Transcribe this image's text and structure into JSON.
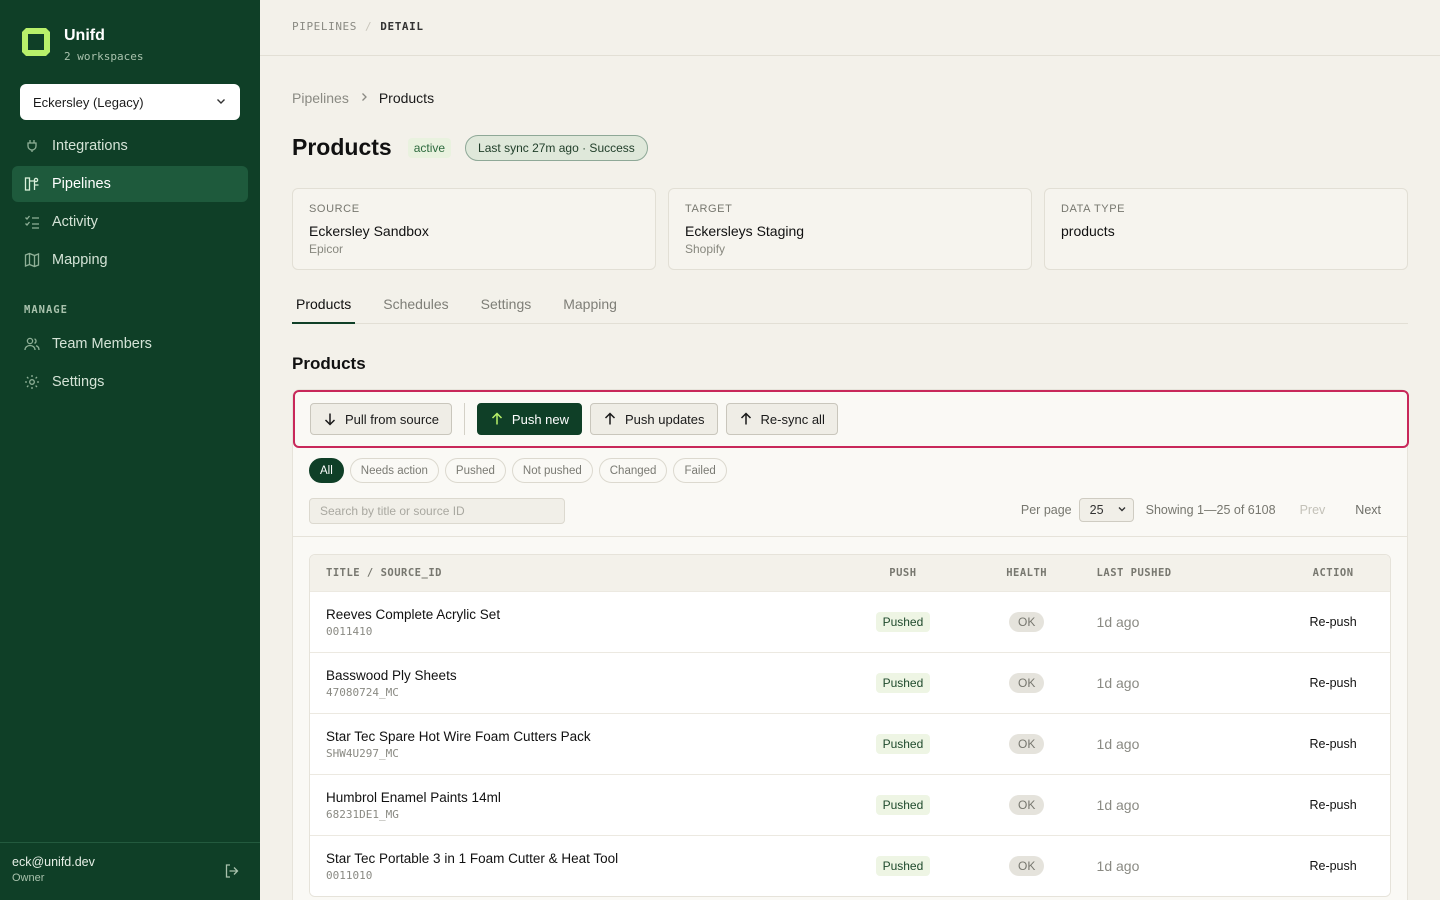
{
  "app": {
    "name": "Unifd",
    "workspaces": "2 workspaces",
    "workspace_selected": "Eckersley (Legacy)"
  },
  "sidebar": {
    "items": [
      {
        "label": "Integrations",
        "icon": "plug-icon"
      },
      {
        "label": "Pipelines",
        "icon": "pipeline-icon",
        "active": true
      },
      {
        "label": "Activity",
        "icon": "list-check-icon"
      },
      {
        "label": "Mapping",
        "icon": "map-icon"
      }
    ],
    "manage_label": "MANAGE",
    "manage_items": [
      {
        "label": "Team Members",
        "icon": "users-icon"
      },
      {
        "label": "Settings",
        "icon": "gear-icon"
      }
    ],
    "user": {
      "email": "eck@unifd.dev",
      "role": "Owner"
    }
  },
  "topbar": {
    "section": "PIPELINES",
    "separator": "/",
    "current": "DETAIL"
  },
  "breadcrumb": {
    "parent": "Pipelines",
    "current": "Products"
  },
  "header": {
    "title": "Products",
    "status": "active",
    "sync": "Last sync 27m ago · Success"
  },
  "cards": [
    {
      "label": "SOURCE",
      "value": "Eckersley Sandbox",
      "sub": "Epicor"
    },
    {
      "label": "TARGET",
      "value": "Eckersleys Staging",
      "sub": "Shopify"
    },
    {
      "label": "DATA TYPE",
      "value": "products",
      "sub": ""
    }
  ],
  "tabs": [
    "Products",
    "Schedules",
    "Settings",
    "Mapping"
  ],
  "section_title": "Products",
  "actions": {
    "pull": "Pull from source",
    "push_new": "Push new",
    "push_updates": "Push updates",
    "resync": "Re-sync all"
  },
  "filters": [
    "All",
    "Needs action",
    "Pushed",
    "Not pushed",
    "Changed",
    "Failed"
  ],
  "search": {
    "placeholder": "Search by title or source ID"
  },
  "pager": {
    "per_page_label": "Per page",
    "per_page": "25",
    "showing": "Showing 1—25 of 6108",
    "prev": "Prev",
    "next": "Next"
  },
  "table": {
    "headers": {
      "title": "TITLE / SOURCE_ID",
      "push": "PUSH",
      "health": "HEALTH",
      "last": "LAST PUSHED",
      "action": "ACTION"
    },
    "rows": [
      {
        "title": "Reeves Complete Acrylic Set",
        "id": "0011410",
        "push": "Pushed",
        "health": "OK",
        "last": "1d ago",
        "action": "Re-push"
      },
      {
        "title": "Basswood Ply Sheets",
        "id": "47080724_MC",
        "push": "Pushed",
        "health": "OK",
        "last": "1d ago",
        "action": "Re-push"
      },
      {
        "title": "Star Tec Spare Hot Wire Foam Cutters Pack",
        "id": "SHW4U297_MC",
        "push": "Pushed",
        "health": "OK",
        "last": "1d ago",
        "action": "Re-push"
      },
      {
        "title": "Humbrol Enamel Paints 14ml",
        "id": "68231DE1_MG",
        "push": "Pushed",
        "health": "OK",
        "last": "1d ago",
        "action": "Re-push"
      },
      {
        "title": "Star Tec Portable 3 in 1 Foam Cutter & Heat Tool",
        "id": "0011010",
        "push": "Pushed",
        "health": "OK",
        "last": "1d ago",
        "action": "Re-push"
      }
    ]
  },
  "colors": {
    "sidebar_bg": "#0f3f27",
    "accent": "#0f3f27",
    "logo": "#b8f06a",
    "highlight_border": "#c8285a"
  }
}
